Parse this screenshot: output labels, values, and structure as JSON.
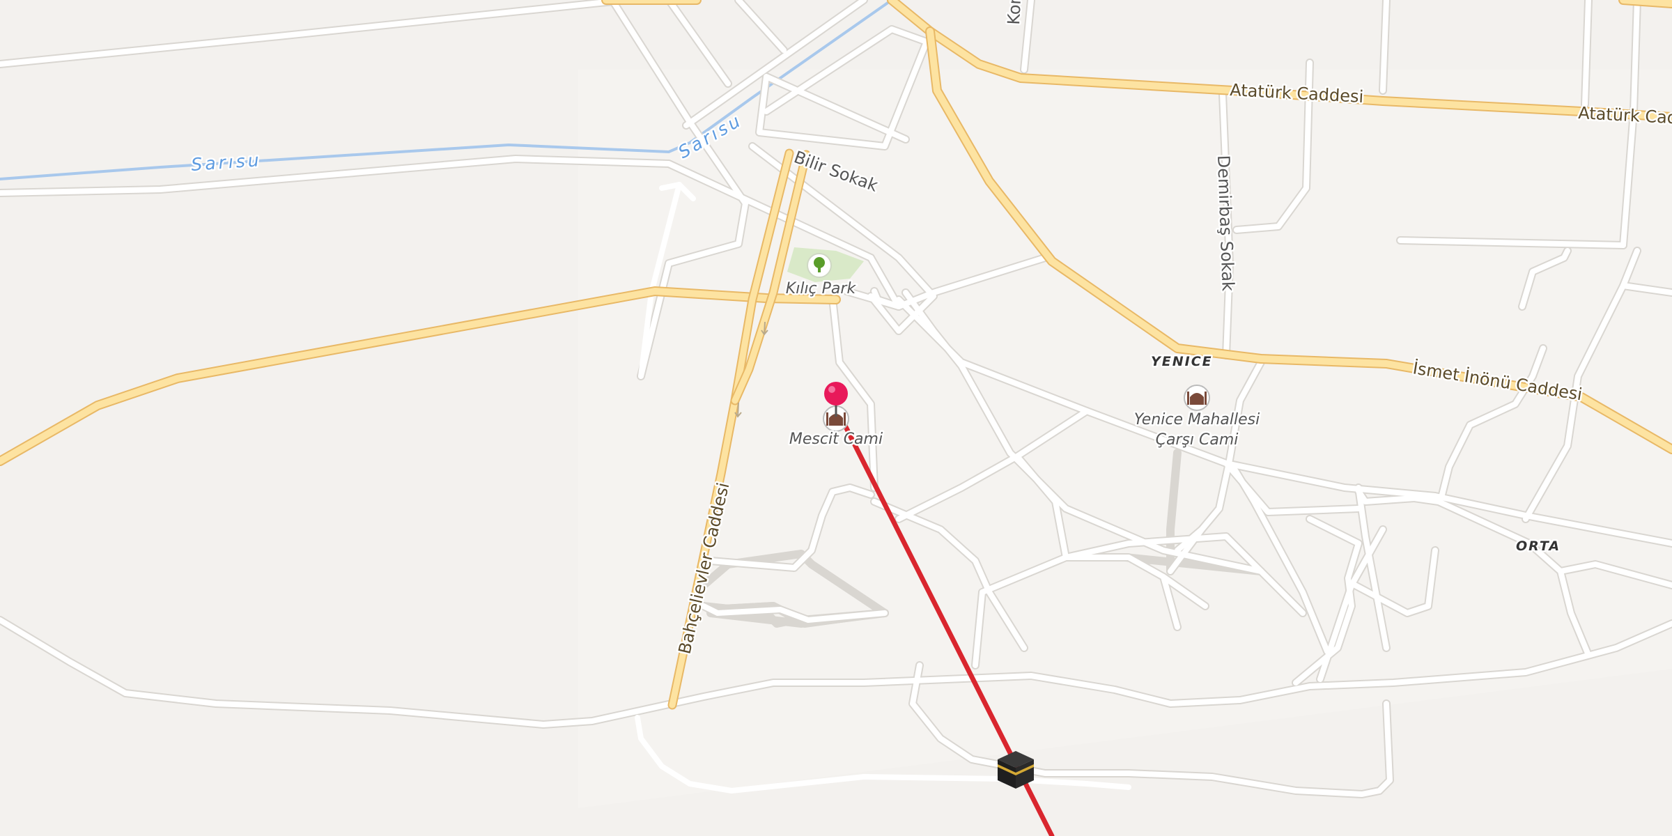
{
  "roads": {
    "ataturk_1": "Atatürk Caddesi",
    "ataturk_2": "Atatürk Caddesi",
    "ismet_inonu": "İsmet İnönü Caddesi",
    "bahcelievler": "Bahçelievler Caddesi",
    "bilir": "Bilir Sokak",
    "demirbas": "Demirbaş Sokak",
    "kon": "Kon"
  },
  "rivers": {
    "sarisu_1": "Sarısu",
    "sarisu_2": "Sarısu"
  },
  "districts": {
    "yenice": "YENICE",
    "orta": "ORTA"
  },
  "pois": {
    "kilic_park": "Kılıç Park",
    "mescit_cami": "Mescit Cami",
    "yenice_cami_line1": "Yenice Mahallesi",
    "yenice_cami_line2": "Çarşı Cami"
  },
  "icons": {
    "park": "tree-icon",
    "mosque": "mosque-icon",
    "location_pin": "location-pin-icon",
    "kaaba": "kaaba-icon"
  },
  "colors": {
    "qibla_line": "#d9262e",
    "location_pin": "#e8195a",
    "major_road": "#fde3a1",
    "river": "#a8c8ec",
    "background": "#f3f1ee"
  }
}
